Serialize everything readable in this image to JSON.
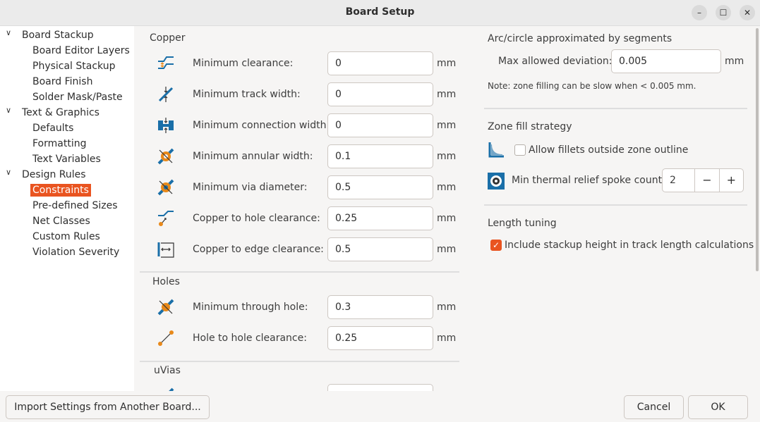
{
  "window": {
    "title": "Board Setup"
  },
  "sidebar": {
    "items": [
      {
        "label": "Board Stackup"
      },
      {
        "label": "Board Editor Layers"
      },
      {
        "label": "Physical Stackup"
      },
      {
        "label": "Board Finish"
      },
      {
        "label": "Solder Mask/Paste"
      },
      {
        "label": "Text & Graphics"
      },
      {
        "label": "Defaults"
      },
      {
        "label": "Formatting"
      },
      {
        "label": "Text Variables"
      },
      {
        "label": "Design Rules"
      },
      {
        "label": "Constraints"
      },
      {
        "label": "Pre-defined Sizes"
      },
      {
        "label": "Net Classes"
      },
      {
        "label": "Custom Rules"
      },
      {
        "label": "Violation Severity"
      }
    ]
  },
  "copper": {
    "heading": "Copper",
    "rows": [
      {
        "label": "Minimum clearance:",
        "value": "0",
        "unit": "mm"
      },
      {
        "label": "Minimum track width:",
        "value": "0",
        "unit": "mm"
      },
      {
        "label": "Minimum connection width:",
        "value": "0",
        "unit": "mm"
      },
      {
        "label": "Minimum annular width:",
        "value": "0.1",
        "unit": "mm"
      },
      {
        "label": "Minimum via diameter:",
        "value": "0.5",
        "unit": "mm"
      },
      {
        "label": "Copper to hole clearance:",
        "value": "0.25",
        "unit": "mm"
      },
      {
        "label": "Copper to edge clearance:",
        "value": "0.5",
        "unit": "mm"
      }
    ]
  },
  "holes": {
    "heading": "Holes",
    "rows": [
      {
        "label": "Minimum through hole:",
        "value": "0.3",
        "unit": "mm"
      },
      {
        "label": "Hole to hole clearance:",
        "value": "0.25",
        "unit": "mm"
      }
    ]
  },
  "uvias": {
    "heading": "uVias"
  },
  "arc": {
    "heading": "Arc/circle approximated by segments",
    "label": "Max allowed deviation:",
    "value": "0.005",
    "unit": "mm",
    "note": "Note: zone filling can be slow when < 0.005 mm."
  },
  "zone": {
    "heading": "Zone fill strategy",
    "fillets_label": "Allow fillets outside zone outline",
    "fillets_checked": false,
    "spoke_label": "Min thermal relief spoke count:",
    "spoke_value": "2",
    "minus": "−",
    "plus": "+"
  },
  "length": {
    "heading": "Length tuning",
    "stackup_label": "Include stackup height in track length calculations",
    "stackup_checked": true
  },
  "footer": {
    "import_label": "Import Settings from Another Board...",
    "cancel_label": "Cancel",
    "ok_label": "OK"
  },
  "colors": {
    "accent": "#e95420",
    "icon_blue": "#1a6fa8"
  }
}
